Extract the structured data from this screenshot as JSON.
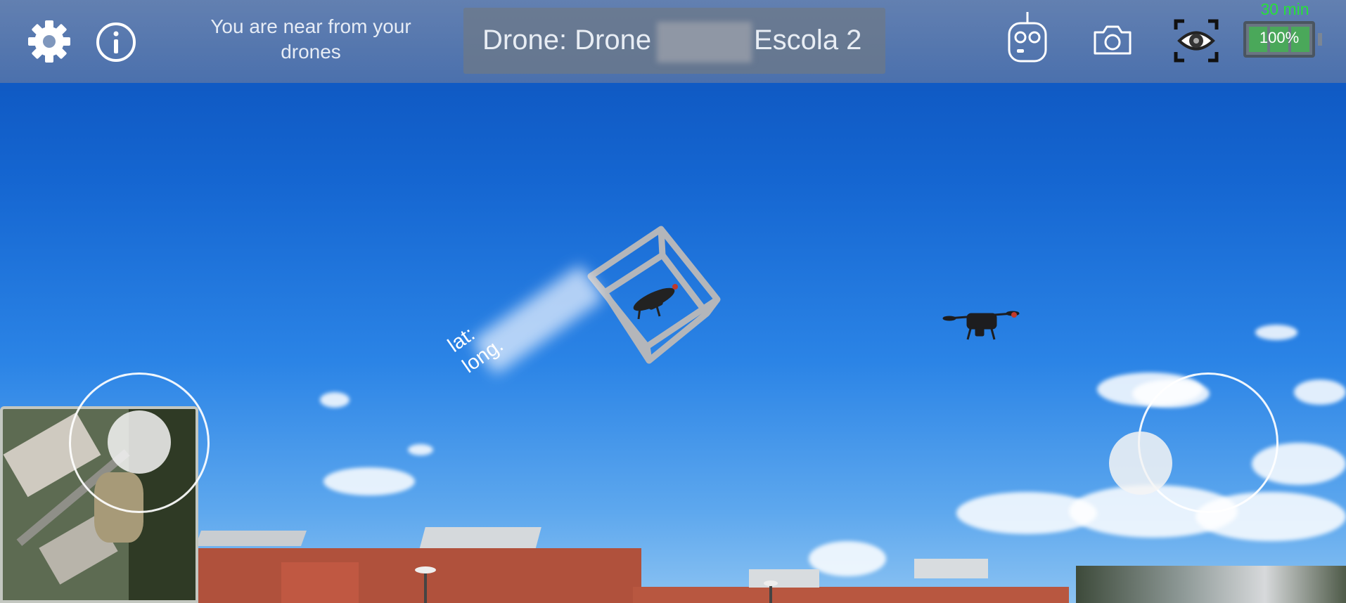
{
  "topbar": {
    "settings_icon": "gear-icon",
    "info_icon": "info-icon",
    "status_text": "You are near from your drones",
    "drone_title_prefix": "Drone: Drone",
    "drone_title_suffix": "Escola 2",
    "controller_icon": "remote-controller-icon",
    "camera_icon": "camera-icon",
    "ar_view_icon": "eye-view-icon",
    "flight_time": "30 min",
    "battery_label": "100%",
    "battery_level": 1.0
  },
  "ar": {
    "lat_label": "lat:",
    "long_label": "long."
  },
  "colors": {
    "flight_time": "#27e03a",
    "battery_cell": "#4aa85a",
    "topbar_bg": "#7088b0"
  }
}
